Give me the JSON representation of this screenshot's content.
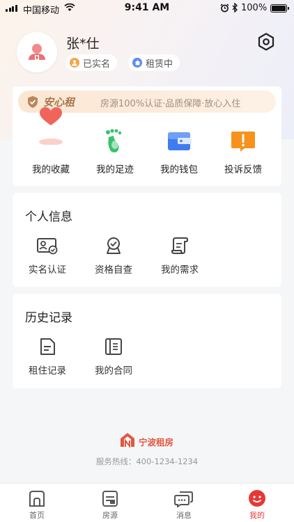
{
  "status_bar": {
    "carrier": "中国移动",
    "time": "9:41 AM",
    "battery": "100%"
  },
  "profile": {
    "name": "张*仕",
    "badges": [
      {
        "label": "已实名",
        "color": "#f5a54a"
      },
      {
        "label": "租赁中",
        "color": "#5b8ef0"
      }
    ]
  },
  "assurance": {
    "title": "安心租",
    "description": "房源100%认证·品质保障·放心入住"
  },
  "quick_actions": [
    {
      "label": "我的收藏",
      "icon": "heart-icon"
    },
    {
      "label": "我的足迹",
      "icon": "footprint-icon"
    },
    {
      "label": "我的钱包",
      "icon": "wallet-icon"
    },
    {
      "label": "投诉反馈",
      "icon": "complaint-icon"
    }
  ],
  "personal_info": {
    "title": "个人信息",
    "items": [
      {
        "label": "实名认证",
        "icon": "id-card-icon"
      },
      {
        "label": "资格自查",
        "icon": "qualification-icon"
      },
      {
        "label": "我的需求",
        "icon": "scroll-icon"
      }
    ]
  },
  "history": {
    "title": "历史记录",
    "items": [
      {
        "label": "租住记录",
        "icon": "record-icon"
      },
      {
        "label": "我的合同",
        "icon": "contract-icon"
      }
    ]
  },
  "footer": {
    "brand": "宁波租房",
    "hotline": "服务热线：400-1234-1234"
  },
  "tabs": [
    {
      "label": "首页",
      "icon": "home-icon"
    },
    {
      "label": "房源",
      "icon": "listing-icon"
    },
    {
      "label": "消息",
      "icon": "message-icon"
    },
    {
      "label": "我的",
      "icon": "profile-icon",
      "active": true
    }
  ],
  "colors": {
    "accent": "#e53935",
    "gold": "#a7784f"
  }
}
